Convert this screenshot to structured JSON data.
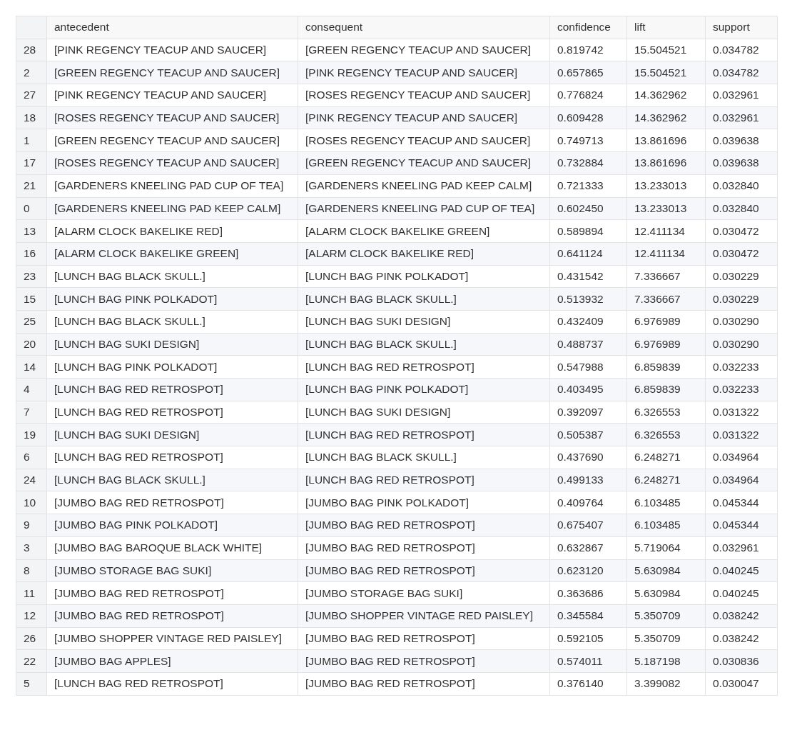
{
  "table": {
    "columns": [
      "",
      "antecedent",
      "consequent",
      "confidence",
      "lift",
      "support"
    ],
    "rows": [
      [
        "28",
        "[PINK REGENCY TEACUP AND SAUCER]",
        "[GREEN REGENCY TEACUP AND SAUCER]",
        "0.819742",
        "15.504521",
        "0.034782"
      ],
      [
        "2",
        "[GREEN REGENCY TEACUP AND SAUCER]",
        "[PINK REGENCY TEACUP AND SAUCER]",
        "0.657865",
        "15.504521",
        "0.034782"
      ],
      [
        "27",
        "[PINK REGENCY TEACUP AND SAUCER]",
        "[ROSES REGENCY TEACUP AND SAUCER]",
        "0.776824",
        "14.362962",
        "0.032961"
      ],
      [
        "18",
        "[ROSES REGENCY TEACUP AND SAUCER]",
        "[PINK REGENCY TEACUP AND SAUCER]",
        "0.609428",
        "14.362962",
        "0.032961"
      ],
      [
        "1",
        "[GREEN REGENCY TEACUP AND SAUCER]",
        "[ROSES REGENCY TEACUP AND SAUCER]",
        "0.749713",
        "13.861696",
        "0.039638"
      ],
      [
        "17",
        "[ROSES REGENCY TEACUP AND SAUCER]",
        "[GREEN REGENCY TEACUP AND SAUCER]",
        "0.732884",
        "13.861696",
        "0.039638"
      ],
      [
        "21",
        "[GARDENERS KNEELING PAD CUP OF TEA]",
        "[GARDENERS KNEELING PAD KEEP CALM]",
        "0.721333",
        "13.233013",
        "0.032840"
      ],
      [
        "0",
        "[GARDENERS KNEELING PAD KEEP CALM]",
        "[GARDENERS KNEELING PAD CUP OF TEA]",
        "0.602450",
        "13.233013",
        "0.032840"
      ],
      [
        "13",
        "[ALARM CLOCK BAKELIKE RED]",
        "[ALARM CLOCK BAKELIKE GREEN]",
        "0.589894",
        "12.411134",
        "0.030472"
      ],
      [
        "16",
        "[ALARM CLOCK BAKELIKE GREEN]",
        "[ALARM CLOCK BAKELIKE RED]",
        "0.641124",
        "12.411134",
        "0.030472"
      ],
      [
        "23",
        "[LUNCH BAG BLACK SKULL.]",
        "[LUNCH BAG PINK POLKADOT]",
        "0.431542",
        "7.336667",
        "0.030229"
      ],
      [
        "15",
        "[LUNCH BAG PINK POLKADOT]",
        "[LUNCH BAG BLACK SKULL.]",
        "0.513932",
        "7.336667",
        "0.030229"
      ],
      [
        "25",
        "[LUNCH BAG BLACK SKULL.]",
        "[LUNCH BAG SUKI DESIGN]",
        "0.432409",
        "6.976989",
        "0.030290"
      ],
      [
        "20",
        "[LUNCH BAG SUKI DESIGN]",
        "[LUNCH BAG BLACK SKULL.]",
        "0.488737",
        "6.976989",
        "0.030290"
      ],
      [
        "14",
        "[LUNCH BAG PINK POLKADOT]",
        "[LUNCH BAG RED RETROSPOT]",
        "0.547988",
        "6.859839",
        "0.032233"
      ],
      [
        "4",
        "[LUNCH BAG RED RETROSPOT]",
        "[LUNCH BAG PINK POLKADOT]",
        "0.403495",
        "6.859839",
        "0.032233"
      ],
      [
        "7",
        "[LUNCH BAG RED RETROSPOT]",
        "[LUNCH BAG SUKI DESIGN]",
        "0.392097",
        "6.326553",
        "0.031322"
      ],
      [
        "19",
        "[LUNCH BAG SUKI DESIGN]",
        "[LUNCH BAG RED RETROSPOT]",
        "0.505387",
        "6.326553",
        "0.031322"
      ],
      [
        "6",
        "[LUNCH BAG RED RETROSPOT]",
        "[LUNCH BAG BLACK SKULL.]",
        "0.437690",
        "6.248271",
        "0.034964"
      ],
      [
        "24",
        "[LUNCH BAG BLACK SKULL.]",
        "[LUNCH BAG RED RETROSPOT]",
        "0.499133",
        "6.248271",
        "0.034964"
      ],
      [
        "10",
        "[JUMBO BAG RED RETROSPOT]",
        "[JUMBO BAG PINK POLKADOT]",
        "0.409764",
        "6.103485",
        "0.045344"
      ],
      [
        "9",
        "[JUMBO BAG PINK POLKADOT]",
        "[JUMBO BAG RED RETROSPOT]",
        "0.675407",
        "6.103485",
        "0.045344"
      ],
      [
        "3",
        "[JUMBO BAG BAROQUE BLACK WHITE]",
        "[JUMBO BAG RED RETROSPOT]",
        "0.632867",
        "5.719064",
        "0.032961"
      ],
      [
        "8",
        "[JUMBO STORAGE BAG SUKI]",
        "[JUMBO BAG RED RETROSPOT]",
        "0.623120",
        "5.630984",
        "0.040245"
      ],
      [
        "11",
        "[JUMBO BAG RED RETROSPOT]",
        "[JUMBO STORAGE BAG SUKI]",
        "0.363686",
        "5.630984",
        "0.040245"
      ],
      [
        "12",
        "[JUMBO BAG RED RETROSPOT]",
        "[JUMBO SHOPPER VINTAGE RED PAISLEY]",
        "0.345584",
        "5.350709",
        "0.038242"
      ],
      [
        "26",
        "[JUMBO SHOPPER VINTAGE RED PAISLEY]",
        "[JUMBO BAG RED RETROSPOT]",
        "0.592105",
        "5.350709",
        "0.038242"
      ],
      [
        "22",
        "[JUMBO BAG APPLES]",
        "[JUMBO BAG RED RETROSPOT]",
        "0.574011",
        "5.187198",
        "0.030836"
      ],
      [
        "5",
        "[LUNCH BAG RED RETROSPOT]",
        "[JUMBO BAG RED RETROSPOT]",
        "0.376140",
        "3.399082",
        "0.030047"
      ]
    ]
  }
}
